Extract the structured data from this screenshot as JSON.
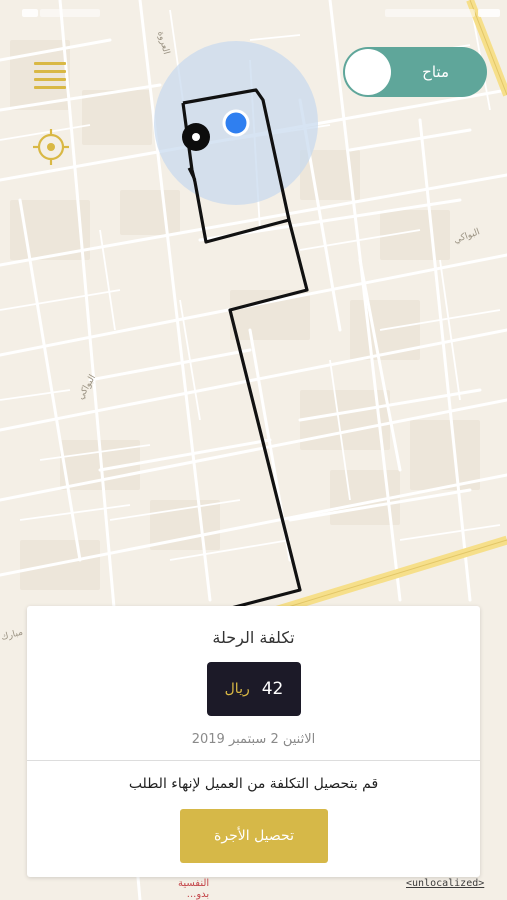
{
  "status_toggle": {
    "label": "متاح",
    "state": "on"
  },
  "map": {
    "street_labels": [
      "البواكي",
      "البواكي",
      "العروة",
      "مبارك"
    ],
    "poi_label": "النفسية",
    "poi_sublabel": "بدو..."
  },
  "trip_card": {
    "title": "تكلفة الرحلة",
    "amount": "42",
    "currency": "ريال",
    "date": "الاثنين 2 سبتمبر 2019",
    "instruction": "قم بتحصيل التكلفة من العميل لإنهاء الطلب",
    "collect_button_label": "تحصيل الأجرة"
  },
  "unlocalized_label": "<unlocalized>",
  "colors": {
    "accent_gold": "#d6b848",
    "toggle_green": "#5fa69a",
    "amount_box": "#1c1a28",
    "route_line": "#111111",
    "current_location": "#2f7ff0",
    "map_bg": "#f4efe6"
  },
  "icons": {
    "menu": "hamburger-icon",
    "locate": "crosshair-icon",
    "location": "location-dot-icon",
    "pickup": "pickup-pin-icon"
  }
}
